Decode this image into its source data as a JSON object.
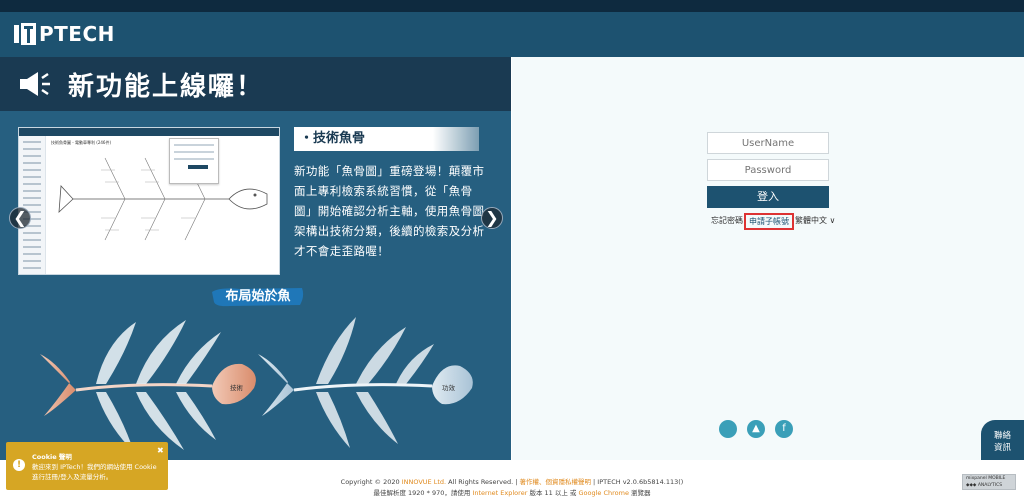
{
  "header": {
    "logo_text": "PTECH"
  },
  "banner": {
    "title": "新功能上線囉！",
    "icon": "megaphone-icon"
  },
  "feature": {
    "title": "・技術魚骨",
    "description": "新功能「魚骨圖」重磅登場！顛覆市面上專利檢索系統習慣，從「魚骨圖」開始確認分析主軸，使用魚骨圖架構出技術分類，後續的檢索及分析才不會走歪路喔！",
    "screenshot_caption": "技術魚骨圖 - 電動車專利 (246件)"
  },
  "carousel": {
    "prev": "❮",
    "next": "❯"
  },
  "fish": {
    "tag": "布局始於魚",
    "head_label_1": "技術",
    "head_label_2": "功效"
  },
  "login": {
    "username_placeholder": "UserName",
    "password_placeholder": "Password",
    "submit_label": "登入",
    "forgot_label": "忘記密碼",
    "apply_label": "申請子帳號",
    "language_label": "繁體中文 ∨"
  },
  "apps": [
    {
      "icon": "apple-icon",
      "glyph": ""
    },
    {
      "icon": "android-icon",
      "glyph": "▲"
    },
    {
      "icon": "facebook-icon",
      "glyph": "f"
    }
  ],
  "contact": {
    "line1": "聯絡",
    "line2": "資訊"
  },
  "footer": {
    "copy_prefix": "Copyright © 2020 ",
    "company": "INNOVUE Ltd.",
    "rights": " All Rights Reserved. | ",
    "policy": "著作權、個資隱私權聲明",
    "version": " | IPTECH v2.0.6b5814.113()",
    "line2_a": "最佳解析度 1920 * 970，請使用 ",
    "ie": "Internet Explorer",
    "line2_b": " 版本 11 以上 或 ",
    "chrome": "Google Chrome",
    "line2_c": " 瀏覽器"
  },
  "mixpanel": {
    "line1": "mixpanel MOBILE",
    "line2": "◆◆◆   ANALYTICS"
  },
  "cookie": {
    "title": "Cookie 聲明",
    "body": "歡迎來到 IPTech！我們的網站使用 Cookie 進行註冊/登入及流量分析。",
    "close": "✖"
  },
  "colors": {
    "brand": "#1d5270",
    "panel": "#265f80",
    "accent": "#e08a1e",
    "cookie": "#d6a624"
  }
}
